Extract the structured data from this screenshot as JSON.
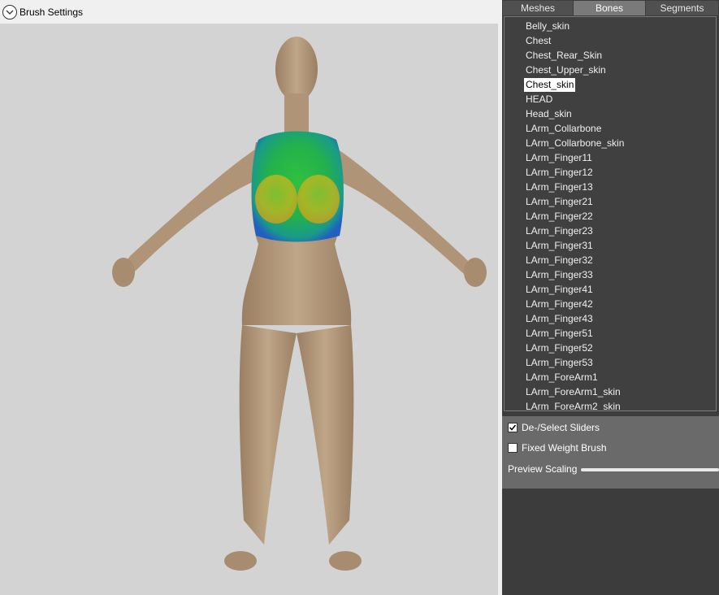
{
  "brush": {
    "title": "Brush Settings",
    "toggle_icon": "chevron-down-icon"
  },
  "tabs": [
    {
      "label": "Meshes",
      "active": false
    },
    {
      "label": "Bones",
      "active": true
    },
    {
      "label": "Segments",
      "active": false
    }
  ],
  "bones": {
    "selected": "Chest_skin",
    "items": [
      "Belly_skin",
      "Chest",
      "Chest_Rear_Skin",
      "Chest_Upper_skin",
      "Chest_skin",
      "HEAD",
      "Head_skin",
      "LArm_Collarbone",
      "LArm_Collarbone_skin",
      "LArm_Finger11",
      "LArm_Finger12",
      "LArm_Finger13",
      "LArm_Finger21",
      "LArm_Finger22",
      "LArm_Finger23",
      "LArm_Finger31",
      "LArm_Finger32",
      "LArm_Finger33",
      "LArm_Finger41",
      "LArm_Finger42",
      "LArm_Finger43",
      "LArm_Finger51",
      "LArm_Finger52",
      "LArm_Finger53",
      "LArm_ForeArm1",
      "LArm_ForeArm1_skin",
      "LArm_ForeArm2_skin"
    ]
  },
  "options": {
    "deselect_sliders": {
      "label": "De-/Select Sliders",
      "checked": true
    },
    "fixed_weight_brush": {
      "label": "Fixed Weight Brush",
      "checked": false
    },
    "preview_scaling": {
      "label": "Preview Scaling"
    }
  },
  "colors": {
    "viewport_bg": "#d3d3d3",
    "panel_bg": "#3c3c3c",
    "active_tab": "#7a7a7a",
    "skin": "#b49a7c",
    "weight_high": "#22b14c",
    "weight_mid": "#c8c020",
    "weight_low": "#2060c0"
  }
}
